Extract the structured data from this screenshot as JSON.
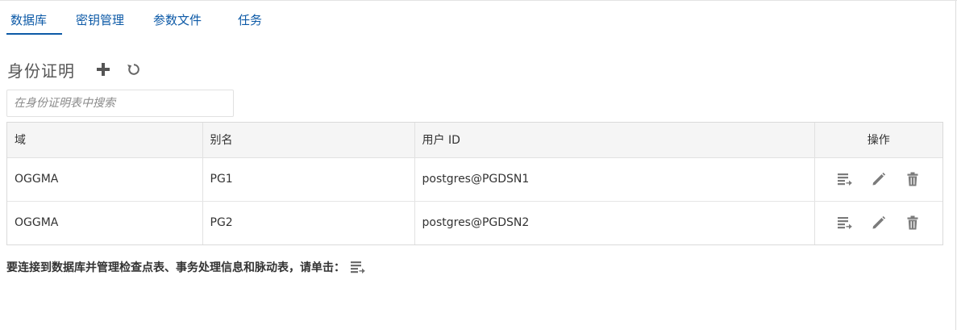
{
  "tabs": [
    {
      "label": "数据库",
      "active": true
    },
    {
      "label": "密钥管理",
      "active": false
    },
    {
      "label": "参数文件",
      "active": false
    },
    {
      "label": "任务",
      "active": false
    }
  ],
  "section": {
    "title": "身份证明",
    "add_icon": "plus-icon",
    "refresh_icon": "refresh-icon"
  },
  "search": {
    "placeholder": "在身份证明表中搜索",
    "value": ""
  },
  "table": {
    "headers": {
      "domain": "域",
      "alias": "别名",
      "user_id": "用户 ID",
      "actions": "操作"
    },
    "rows": [
      {
        "domain": "OGGMA",
        "alias": "PG1",
        "user_id": "postgres@PGDSN1"
      },
      {
        "domain": "OGGMA",
        "alias": "PG2",
        "user_id": "postgres@PGDSN2"
      }
    ],
    "row_action_icons": [
      "connect-database-icon",
      "edit-pencil-icon",
      "delete-trash-icon"
    ]
  },
  "footer": {
    "note": "要连接到数据库并管理检查点表、事务处理信息和脉动表，请单击：",
    "icon": "connect-database-icon"
  },
  "colors": {
    "accent": "#0d5aa7",
    "icon_gray": "#7b7b7b",
    "header_bg": "#f5f5f5"
  }
}
